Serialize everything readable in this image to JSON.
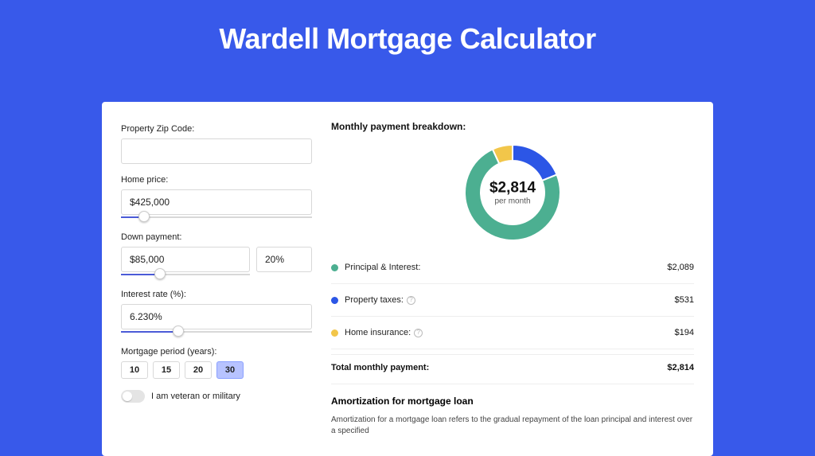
{
  "title": "Wardell Mortgage Calculator",
  "inputs": {
    "zip_label": "Property Zip Code:",
    "zip_value": "",
    "price_label": "Home price:",
    "price_value": "$425,000",
    "down_label": "Down payment:",
    "down_value": "$85,000",
    "down_pct": "20%",
    "rate_label": "Interest rate (%):",
    "rate_value": "6.230%",
    "period_label": "Mortgage period (years):",
    "periods": [
      "10",
      "15",
      "20",
      "30"
    ],
    "period_selected": "30",
    "vet_label": "I am veteran or military"
  },
  "breakdown": {
    "title": "Monthly payment breakdown:",
    "center_value": "$2,814",
    "center_sub": "per month",
    "rows": [
      {
        "color": "#4caf91",
        "label": "Principal & Interest:",
        "value": "$2,089",
        "help": false
      },
      {
        "color": "#2c56e6",
        "label": "Property taxes:",
        "value": "$531",
        "help": true
      },
      {
        "color": "#f2c64a",
        "label": "Home insurance:",
        "value": "$194",
        "help": true
      }
    ],
    "total_label": "Total monthly payment:",
    "total_value": "$2,814"
  },
  "amort": {
    "title": "Amortization for mortgage loan",
    "text": "Amortization for a mortgage loan refers to the gradual repayment of the loan principal and interest over a specified"
  },
  "chart_data": {
    "type": "pie",
    "title": "Monthly payment breakdown",
    "series": [
      {
        "name": "Principal & Interest",
        "value": 2089,
        "color": "#4caf91"
      },
      {
        "name": "Property taxes",
        "value": 531,
        "color": "#2c56e6"
      },
      {
        "name": "Home insurance",
        "value": 194,
        "color": "#f2c64a"
      }
    ],
    "total": 2814,
    "center_label": "$2,814 per month",
    "donut": true
  }
}
